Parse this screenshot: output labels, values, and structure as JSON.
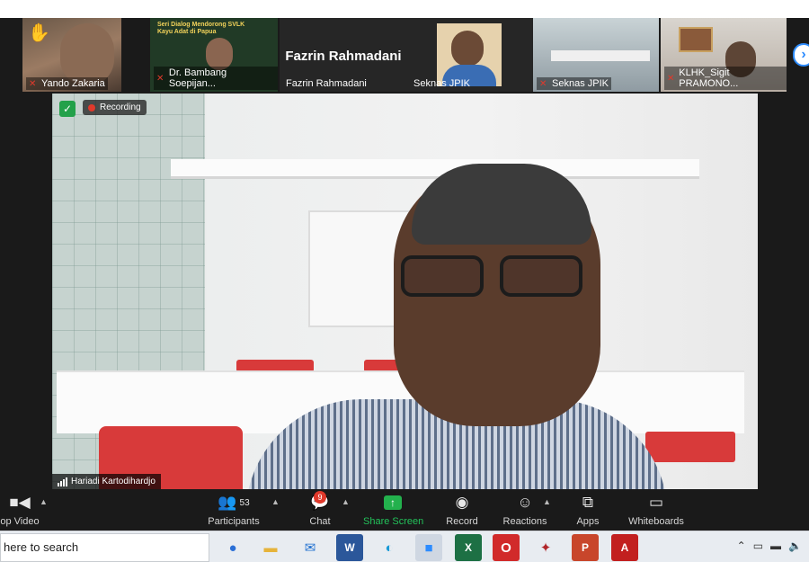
{
  "gallery": {
    "tiles": [
      {
        "name": "Yando Zakaria",
        "muted": true,
        "hand_raised": true
      },
      {
        "name": "Dr. Bambang Soepijan...",
        "muted": true,
        "banner_title": "Seri Dialog Mendorong SVLK Kayu Adat di Papua"
      },
      {
        "name": "Fazrin Rahmadani",
        "muted": false,
        "big_name": "Fazrin Rahmadani"
      },
      {
        "name": "Seknas JPIK",
        "muted": false
      },
      {
        "name": "Seknas JPIK",
        "muted": true
      },
      {
        "name": "KLHK_Sigit PRAMONO...",
        "muted": true
      }
    ],
    "next_icon": "chevron-right-icon"
  },
  "main_video": {
    "recording_label": "Recording",
    "speaker_name": "Hariadi Kartodihardjo"
  },
  "toolbar": {
    "stop_video": "op Video",
    "participants": "Participants",
    "participants_count": "53",
    "chat": "Chat",
    "chat_badge": "9",
    "share_screen": "Share Screen",
    "record": "Record",
    "reactions": "Reactions",
    "apps": "Apps",
    "whiteboards": "Whiteboards",
    "share_color": "#23b14d"
  },
  "taskbar": {
    "search_text": "here to search",
    "apps": [
      "people-icon",
      "file-explorer-icon",
      "mail-icon",
      "word-icon",
      "edge-icon",
      "zoom-icon",
      "excel-icon",
      "opera-icon",
      "game-icon",
      "powerpoint-icon",
      "acrobat-icon"
    ]
  }
}
